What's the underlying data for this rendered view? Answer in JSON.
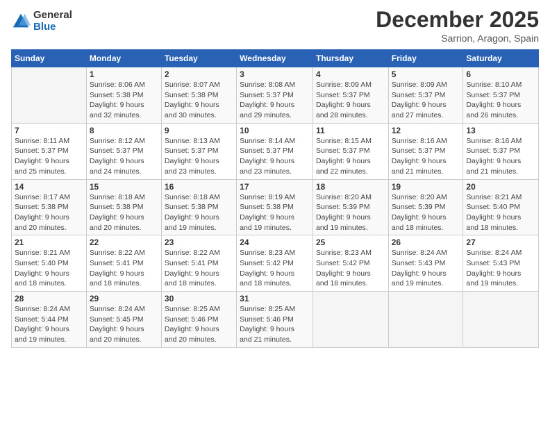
{
  "header": {
    "logo_general": "General",
    "logo_blue": "Blue",
    "month": "December 2025",
    "location": "Sarrion, Aragon, Spain"
  },
  "days_of_week": [
    "Sunday",
    "Monday",
    "Tuesday",
    "Wednesday",
    "Thursday",
    "Friday",
    "Saturday"
  ],
  "weeks": [
    [
      {
        "day": "",
        "info": ""
      },
      {
        "day": "1",
        "info": "Sunrise: 8:06 AM\nSunset: 5:38 PM\nDaylight: 9 hours\nand 32 minutes."
      },
      {
        "day": "2",
        "info": "Sunrise: 8:07 AM\nSunset: 5:38 PM\nDaylight: 9 hours\nand 30 minutes."
      },
      {
        "day": "3",
        "info": "Sunrise: 8:08 AM\nSunset: 5:37 PM\nDaylight: 9 hours\nand 29 minutes."
      },
      {
        "day": "4",
        "info": "Sunrise: 8:09 AM\nSunset: 5:37 PM\nDaylight: 9 hours\nand 28 minutes."
      },
      {
        "day": "5",
        "info": "Sunrise: 8:09 AM\nSunset: 5:37 PM\nDaylight: 9 hours\nand 27 minutes."
      },
      {
        "day": "6",
        "info": "Sunrise: 8:10 AM\nSunset: 5:37 PM\nDaylight: 9 hours\nand 26 minutes."
      }
    ],
    [
      {
        "day": "7",
        "info": "Sunrise: 8:11 AM\nSunset: 5:37 PM\nDaylight: 9 hours\nand 25 minutes."
      },
      {
        "day": "8",
        "info": "Sunrise: 8:12 AM\nSunset: 5:37 PM\nDaylight: 9 hours\nand 24 minutes."
      },
      {
        "day": "9",
        "info": "Sunrise: 8:13 AM\nSunset: 5:37 PM\nDaylight: 9 hours\nand 23 minutes."
      },
      {
        "day": "10",
        "info": "Sunrise: 8:14 AM\nSunset: 5:37 PM\nDaylight: 9 hours\nand 23 minutes."
      },
      {
        "day": "11",
        "info": "Sunrise: 8:15 AM\nSunset: 5:37 PM\nDaylight: 9 hours\nand 22 minutes."
      },
      {
        "day": "12",
        "info": "Sunrise: 8:16 AM\nSunset: 5:37 PM\nDaylight: 9 hours\nand 21 minutes."
      },
      {
        "day": "13",
        "info": "Sunrise: 8:16 AM\nSunset: 5:37 PM\nDaylight: 9 hours\nand 21 minutes."
      }
    ],
    [
      {
        "day": "14",
        "info": "Sunrise: 8:17 AM\nSunset: 5:38 PM\nDaylight: 9 hours\nand 20 minutes."
      },
      {
        "day": "15",
        "info": "Sunrise: 8:18 AM\nSunset: 5:38 PM\nDaylight: 9 hours\nand 20 minutes."
      },
      {
        "day": "16",
        "info": "Sunrise: 8:18 AM\nSunset: 5:38 PM\nDaylight: 9 hours\nand 19 minutes."
      },
      {
        "day": "17",
        "info": "Sunrise: 8:19 AM\nSunset: 5:38 PM\nDaylight: 9 hours\nand 19 minutes."
      },
      {
        "day": "18",
        "info": "Sunrise: 8:20 AM\nSunset: 5:39 PM\nDaylight: 9 hours\nand 19 minutes."
      },
      {
        "day": "19",
        "info": "Sunrise: 8:20 AM\nSunset: 5:39 PM\nDaylight: 9 hours\nand 18 minutes."
      },
      {
        "day": "20",
        "info": "Sunrise: 8:21 AM\nSunset: 5:40 PM\nDaylight: 9 hours\nand 18 minutes."
      }
    ],
    [
      {
        "day": "21",
        "info": "Sunrise: 8:21 AM\nSunset: 5:40 PM\nDaylight: 9 hours\nand 18 minutes."
      },
      {
        "day": "22",
        "info": "Sunrise: 8:22 AM\nSunset: 5:41 PM\nDaylight: 9 hours\nand 18 minutes."
      },
      {
        "day": "23",
        "info": "Sunrise: 8:22 AM\nSunset: 5:41 PM\nDaylight: 9 hours\nand 18 minutes."
      },
      {
        "day": "24",
        "info": "Sunrise: 8:23 AM\nSunset: 5:42 PM\nDaylight: 9 hours\nand 18 minutes."
      },
      {
        "day": "25",
        "info": "Sunrise: 8:23 AM\nSunset: 5:42 PM\nDaylight: 9 hours\nand 18 minutes."
      },
      {
        "day": "26",
        "info": "Sunrise: 8:24 AM\nSunset: 5:43 PM\nDaylight: 9 hours\nand 19 minutes."
      },
      {
        "day": "27",
        "info": "Sunrise: 8:24 AM\nSunset: 5:43 PM\nDaylight: 9 hours\nand 19 minutes."
      }
    ],
    [
      {
        "day": "28",
        "info": "Sunrise: 8:24 AM\nSunset: 5:44 PM\nDaylight: 9 hours\nand 19 minutes."
      },
      {
        "day": "29",
        "info": "Sunrise: 8:24 AM\nSunset: 5:45 PM\nDaylight: 9 hours\nand 20 minutes."
      },
      {
        "day": "30",
        "info": "Sunrise: 8:25 AM\nSunset: 5:46 PM\nDaylight: 9 hours\nand 20 minutes."
      },
      {
        "day": "31",
        "info": "Sunrise: 8:25 AM\nSunset: 5:46 PM\nDaylight: 9 hours\nand 21 minutes."
      },
      {
        "day": "",
        "info": ""
      },
      {
        "day": "",
        "info": ""
      },
      {
        "day": "",
        "info": ""
      }
    ]
  ]
}
